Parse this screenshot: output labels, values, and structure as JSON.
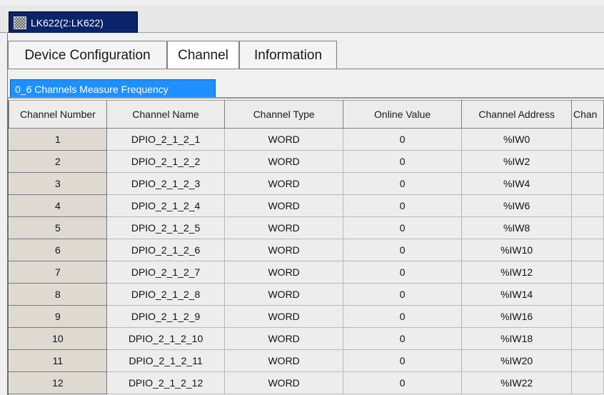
{
  "document_tab": {
    "icon": "module-icon",
    "label": "LK622(2:LK622)"
  },
  "config_tabs": [
    {
      "label": "Device Configuration",
      "active": false
    },
    {
      "label": "Channel",
      "active": true
    },
    {
      "label": "Information",
      "active": false
    }
  ],
  "sub_tab": {
    "label": "0_6 Channels Measure Frequency"
  },
  "columns": [
    "Channel Number",
    "Channel Name",
    "Channel Type",
    "Online Value",
    "Channel Address",
    "Chan"
  ],
  "rows": [
    {
      "number": "1",
      "name": "DPIO_2_1_2_1",
      "type": "WORD",
      "online_value": "0",
      "address": "%IW0"
    },
    {
      "number": "2",
      "name": "DPIO_2_1_2_2",
      "type": "WORD",
      "online_value": "0",
      "address": "%IW2"
    },
    {
      "number": "3",
      "name": "DPIO_2_1_2_3",
      "type": "WORD",
      "online_value": "0",
      "address": "%IW4"
    },
    {
      "number": "4",
      "name": "DPIO_2_1_2_4",
      "type": "WORD",
      "online_value": "0",
      "address": "%IW6"
    },
    {
      "number": "5",
      "name": "DPIO_2_1_2_5",
      "type": "WORD",
      "online_value": "0",
      "address": "%IW8"
    },
    {
      "number": "6",
      "name": "DPIO_2_1_2_6",
      "type": "WORD",
      "online_value": "0",
      "address": "%IW10"
    },
    {
      "number": "7",
      "name": "DPIO_2_1_2_7",
      "type": "WORD",
      "online_value": "0",
      "address": "%IW12"
    },
    {
      "number": "8",
      "name": "DPIO_2_1_2_8",
      "type": "WORD",
      "online_value": "0",
      "address": "%IW14"
    },
    {
      "number": "9",
      "name": "DPIO_2_1_2_9",
      "type": "WORD",
      "online_value": "0",
      "address": "%IW16"
    },
    {
      "number": "10",
      "name": "DPIO_2_1_2_10",
      "type": "WORD",
      "online_value": "0",
      "address": "%IW18"
    },
    {
      "number": "11",
      "name": "DPIO_2_1_2_11",
      "type": "WORD",
      "online_value": "0",
      "address": "%IW20"
    },
    {
      "number": "12",
      "name": "DPIO_2_1_2_12",
      "type": "WORD",
      "online_value": "0",
      "address": "%IW22"
    }
  ]
}
